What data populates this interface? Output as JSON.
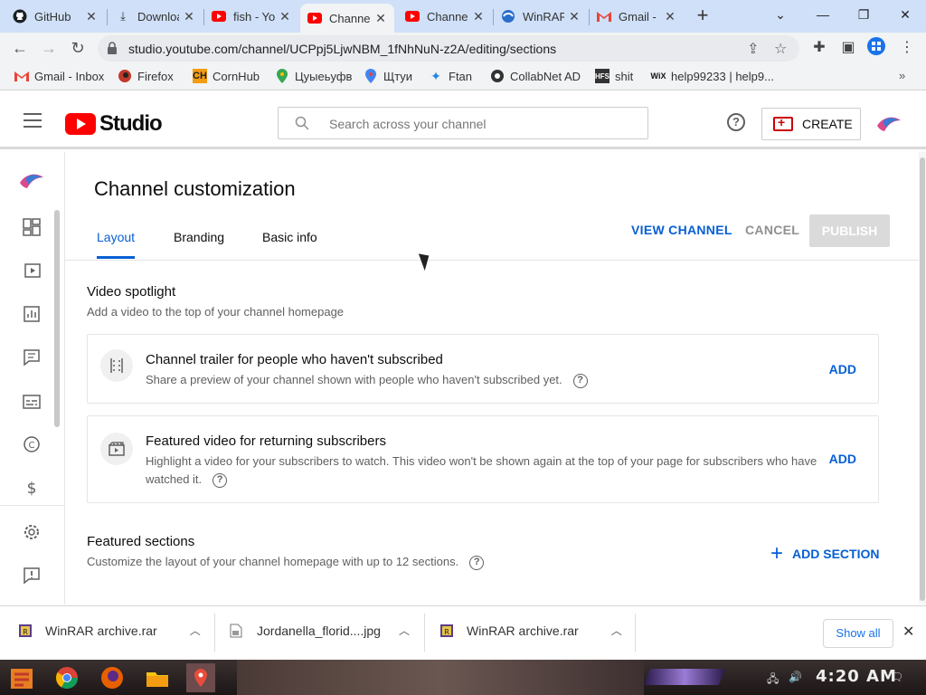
{
  "browser": {
    "tabs": [
      {
        "title": "GitHub",
        "icon": "github-icon"
      },
      {
        "title": "Downloads",
        "icon": "download-icon"
      },
      {
        "title": "fish - YouTube",
        "icon": "youtube-icon"
      },
      {
        "title": "Channel",
        "icon": "youtube-icon"
      },
      {
        "title": "Channel",
        "icon": "youtube-icon"
      },
      {
        "title": "WinRAR",
        "icon": "winrar-icon"
      },
      {
        "title": "Gmail -",
        "icon": "gmail-icon"
      }
    ],
    "url": "studio.youtube.com/channel/UCPpj5LjwNBM_1fNhNuN-z2A/editing/sections",
    "bookmarks": [
      {
        "label": "Gmail - Inbox",
        "icon": "gmail-icon"
      },
      {
        "label": "Firefox",
        "icon": "firefox-icon"
      },
      {
        "label": "CornHub",
        "icon": "ch-icon"
      },
      {
        "label": "Цуыеьуфв",
        "icon": "location-pin-icon"
      },
      {
        "label": "Щтуи",
        "icon": "location-pin-icon"
      },
      {
        "label": "Ftan",
        "icon": "star-icon"
      },
      {
        "label": "CollabNet AD",
        "icon": "collabnet-icon"
      },
      {
        "label": "shit",
        "icon": "hfs-icon"
      },
      {
        "label": "help99233 | help9...",
        "icon": "wix-icon"
      }
    ]
  },
  "studio": {
    "logo_text": "Studio",
    "search_placeholder": "Search across your channel",
    "help_glyph": "?",
    "create_label": "CREATE"
  },
  "page": {
    "title": "Channel customization",
    "tabs": [
      "Layout",
      "Branding",
      "Basic info"
    ],
    "active_tab": "Layout",
    "view_channel": "VIEW CHANNEL",
    "cancel": "CANCEL",
    "publish": "PUBLISH"
  },
  "video_spotlight": {
    "title": "Video spotlight",
    "subtitle": "Add a video to the top of your channel homepage",
    "cards": [
      {
        "title": "Channel trailer for people who haven't subscribed",
        "desc": "Share a preview of your channel shown with people who haven't subscribed yet.",
        "action": "ADD",
        "icon": "trailer-icon"
      },
      {
        "title": "Featured video for returning subscribers",
        "desc": "Highlight a video for your subscribers to watch. This video won't be shown again at the top of your page for subscribers who have watched it.",
        "action": "ADD",
        "icon": "clapperboard-icon"
      }
    ]
  },
  "featured_sections": {
    "title": "Featured sections",
    "subtitle": "Customize the layout of your channel homepage with up to 12 sections.",
    "add_section": "ADD SECTION"
  },
  "downloads": [
    {
      "name": "WinRAR archive.rar"
    },
    {
      "name": "Jordanella_florid....jpg"
    },
    {
      "name": "WinRAR archive.rar"
    }
  ],
  "downloads_show_all": "Show all",
  "taskbar": {
    "clock": "4:20 AM"
  },
  "colors": {
    "accent": "#065fd4",
    "youtube_red": "#ff0000",
    "publish_disabled": "#dadada"
  }
}
